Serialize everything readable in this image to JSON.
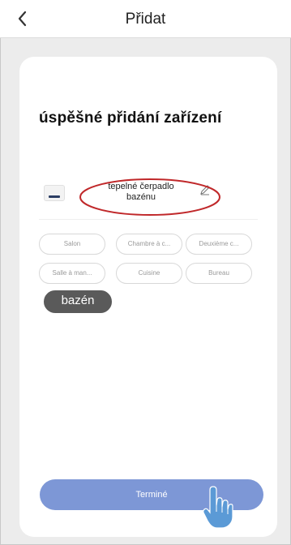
{
  "header": {
    "back_icon": "chevron-left-icon",
    "title": "Přidat"
  },
  "main": {
    "success_title": "úspěšné přidání zařízení",
    "device": {
      "name_line1": "tepelné čerpadlo",
      "name_line2": "bazénu",
      "edit_icon": "pencil-icon"
    },
    "rooms": [
      {
        "label": "Salon"
      },
      {
        "label": "Chambre à c..."
      },
      {
        "label": "Deuxième c..."
      },
      {
        "label": "Salle à man..."
      },
      {
        "label": "Cuisine"
      },
      {
        "label": "Bureau"
      },
      {
        "label": "bazén",
        "selected": true
      }
    ],
    "finish_label": "Terminé"
  },
  "colors": {
    "accent": "#7d97d6",
    "selected_chip": "#5a5a5a",
    "annotation": "#c0282a"
  }
}
